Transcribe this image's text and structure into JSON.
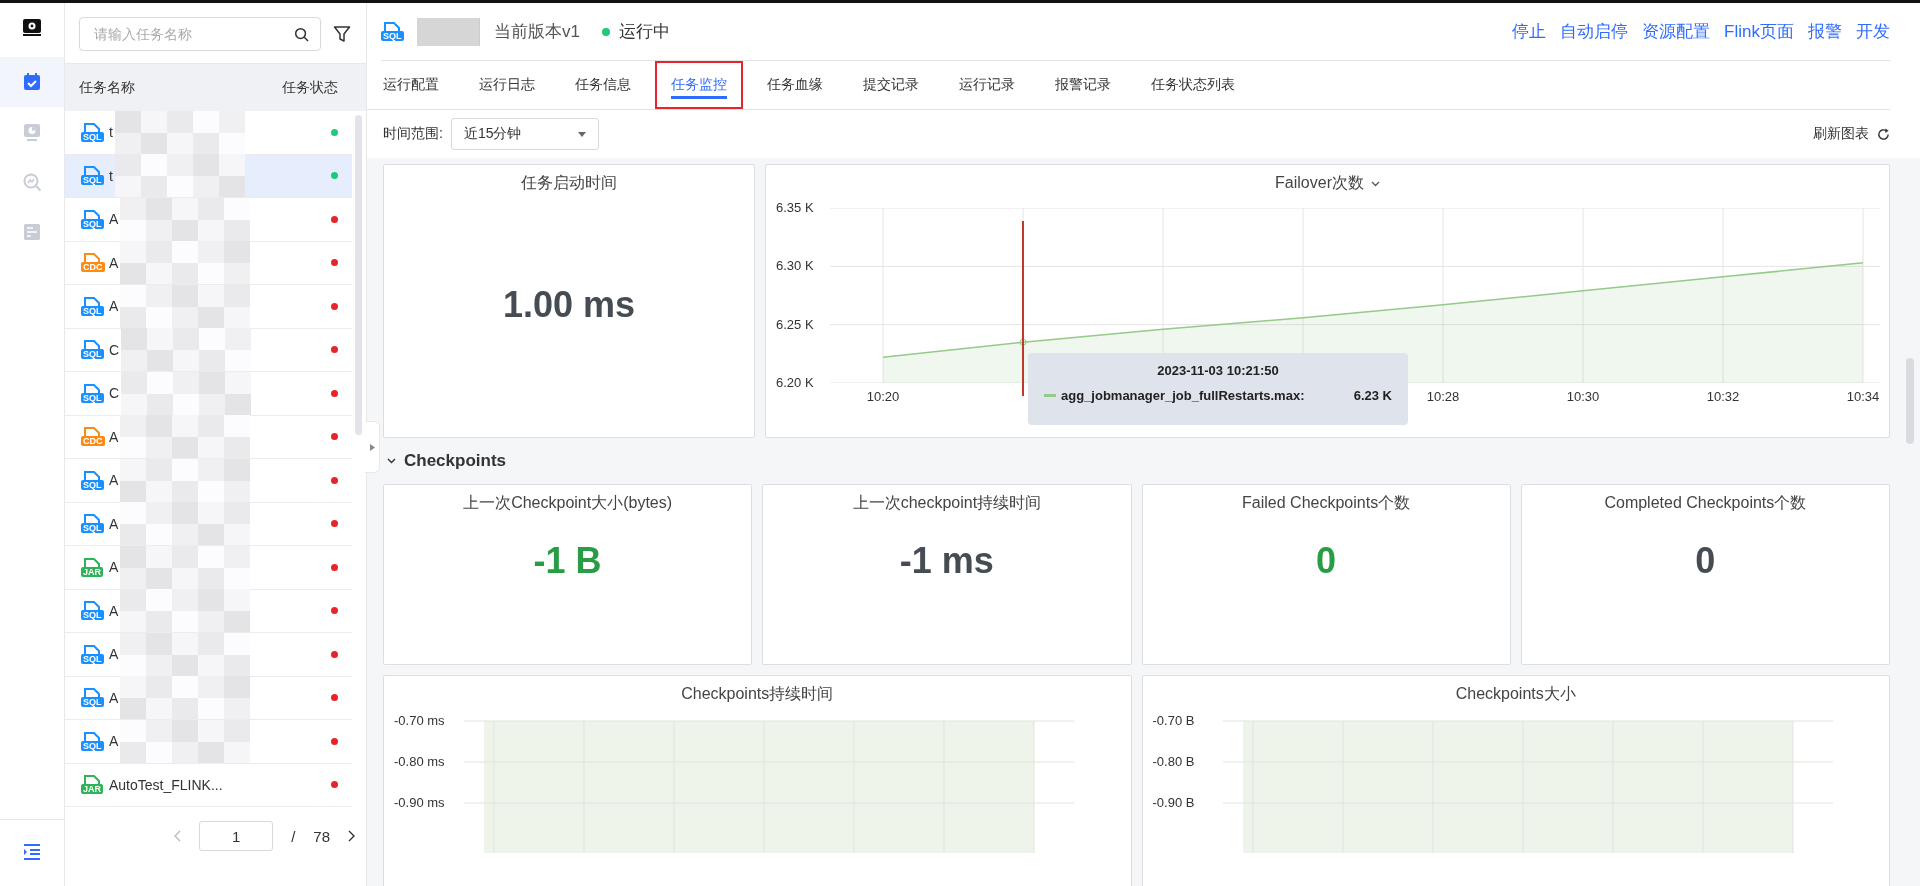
{
  "header": {
    "version": "当前版本v1",
    "status": "运行中",
    "badge": "SQL",
    "actions": [
      "停止",
      "自动启停",
      "资源配置",
      "Flink页面",
      "报警",
      "开发"
    ]
  },
  "rail": {
    "items": [
      {
        "kind": "tasks",
        "selected": true
      },
      {
        "kind": "monitor",
        "selected": false
      },
      {
        "kind": "analysis",
        "selected": false
      },
      {
        "kind": "settings",
        "selected": false
      }
    ]
  },
  "task_list": {
    "search": {
      "placeholder": "请输入任务名称"
    },
    "columns": [
      "任务名称",
      "任务状态"
    ],
    "rows": [
      {
        "kind": "sql",
        "badge": "SQL",
        "name": "t",
        "color": "#1fc97a",
        "selected": false
      },
      {
        "kind": "sql",
        "badge": "SQL",
        "name": "t",
        "color": "#1fc97a",
        "selected": true
      },
      {
        "kind": "sql",
        "badge": "SQL",
        "name": "A",
        "color": "#e5242b",
        "selected": false
      },
      {
        "kind": "cdc",
        "badge": "CDC",
        "name": "A",
        "color": "#e5242b",
        "selected": false
      },
      {
        "kind": "sql",
        "badge": "SQL",
        "name": "A",
        "color": "#e5242b",
        "selected": false
      },
      {
        "kind": "sql",
        "badge": "SQL",
        "name": "C",
        "color": "#e5242b",
        "selected": false
      },
      {
        "kind": "sql",
        "badge": "SQL",
        "name": "C",
        "color": "#e5242b",
        "selected": false
      },
      {
        "kind": "cdc",
        "badge": "CDC",
        "name": "A",
        "color": "#e5242b",
        "selected": false
      },
      {
        "kind": "sql",
        "badge": "SQL",
        "name": "A",
        "color": "#e5242b",
        "selected": false
      },
      {
        "kind": "sql",
        "badge": "SQL",
        "name": "A",
        "color": "#e5242b",
        "selected": false
      },
      {
        "kind": "jar",
        "badge": "JAR",
        "name": "A",
        "color": "#e5242b",
        "selected": false
      },
      {
        "kind": "sql",
        "badge": "SQL",
        "name": "A",
        "color": "#e5242b",
        "selected": false
      },
      {
        "kind": "sql",
        "badge": "SQL",
        "name": "A",
        "color": "#e5242b",
        "selected": false
      },
      {
        "kind": "sql",
        "badge": "SQL",
        "name": "A",
        "color": "#e5242b",
        "selected": false
      },
      {
        "kind": "sql",
        "badge": "SQL",
        "name": "A",
        "color": "#e5242b",
        "selected": false
      },
      {
        "kind": "jar",
        "badge": "JAR",
        "name": "AutoTest_FLINK...",
        "color": "#e5242b",
        "selected": false
      }
    ],
    "pagination": {
      "page": "1",
      "separator": "/",
      "total": "78"
    }
  },
  "tabs": [
    {
      "label": "运行配置",
      "selected": false
    },
    {
      "label": "运行日志",
      "selected": false
    },
    {
      "label": "任务信息",
      "selected": false
    },
    {
      "label": "任务监控",
      "selected": true
    },
    {
      "label": "任务血缘",
      "selected": false
    },
    {
      "label": "提交记录",
      "selected": false
    },
    {
      "label": "运行记录",
      "selected": false
    },
    {
      "label": "报警记录",
      "selected": false
    },
    {
      "label": "任务状态列表",
      "selected": false
    }
  ],
  "toolbar": {
    "time_range_label": "时间范围:",
    "time_range": "近15分钟",
    "refresh": "刷新图表"
  },
  "startup_panel": {
    "title": "任务启动时间",
    "value": "1.00 ms"
  },
  "failover_panel": {
    "chart_data": {
      "type": "area",
      "title": "Failover次数",
      "categories": [
        "10:20",
        null,
        null,
        null,
        "10:28",
        "10:30",
        "10:32",
        "10:34"
      ],
      "series": [
        {
          "name": "agg_jobmanager_job_fullRestarts.max",
          "color": "#96c98a",
          "values": [
            6.222,
            6.235,
            6.246,
            6.256,
            6.267,
            6.279,
            6.291,
            6.303
          ]
        }
      ],
      "ylim": [
        6.2,
        6.35
      ],
      "grid": true,
      "yticks": [
        {
          "value": 6.2,
          "label": "6.20 K"
        },
        {
          "value": 6.25,
          "label": "6.25 K"
        },
        {
          "value": 6.3,
          "label": "6.30 K"
        },
        {
          "value": 6.35,
          "label": "6.35 K"
        }
      ]
    },
    "tooltip": {
      "time": "2023-11-03 10:21:50",
      "separator": ":",
      "value": "6.23 K"
    }
  },
  "checkpoints": {
    "title": "Checkpoints",
    "expanded": true,
    "stats": [
      {
        "title": "上一次Checkpoint大小(bytes)",
        "value": "-1 B",
        "color": "#299c46"
      },
      {
        "title": "上一次checkpoint持续时间",
        "value": "-1 ms",
        "color": "#464c54"
      },
      {
        "title": "Failed Checkpoints个数",
        "value": "0",
        "color": "#299c46"
      },
      {
        "title": "Completed Checkpoints个数",
        "value": "0",
        "color": "#464c54"
      }
    ],
    "charts": [
      {
        "title": "Checkpoints持续时间",
        "y_labels": [
          "-0.70 ms",
          "-0.80 ms",
          "-0.90 ms"
        ]
      },
      {
        "title": "Checkpoints大小",
        "y_labels": [
          "-0.70 B",
          "-0.80 B",
          "-0.90 B"
        ]
      }
    ]
  }
}
